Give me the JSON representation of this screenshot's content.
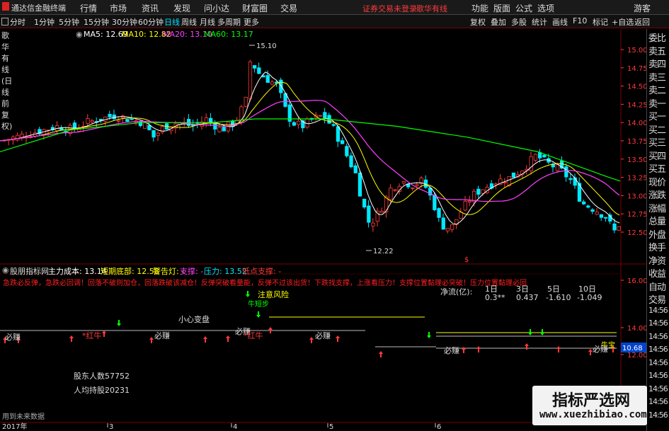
{
  "topbar": {
    "logo": "通达信金融终端",
    "menus": [
      "行情",
      "市场",
      "资讯",
      "发现",
      "问小达",
      "财富圈",
      "交易"
    ],
    "warning": "证券交易未登录",
    "stock_name": "歌华有线",
    "right_menus": [
      "功能",
      "版面",
      "公式",
      "选项"
    ],
    "user": "游客"
  },
  "toolbar": {
    "periods": [
      "分时",
      "1分钟",
      "5分钟",
      "15分钟",
      "30分钟",
      "60分钟",
      "日线",
      "周线",
      "月线",
      "多周期",
      "更多"
    ],
    "active_period": "日线",
    "buttons": [
      "复权",
      "叠加",
      "多股",
      "统计",
      "画线",
      "F10",
      "标记",
      "+自选",
      "返回"
    ]
  },
  "infobar": {
    "title": "歌华有线(日线 前复权)",
    "ma5": "MA5: 12.69",
    "ma10": "MA10: 12.82",
    "ma20": "MA20: 13.10",
    "ma60": "MA60: 13.17"
  },
  "price_axis": [
    "15.00",
    "14.75",
    "14.50",
    "14.25",
    "14.00",
    "13.75",
    "13.50",
    "13.25",
    "13.00",
    "12.75",
    "12.50"
  ],
  "annotations": {
    "high": "15.10",
    "low": "12.22",
    "marker": "$"
  },
  "indicator_bar": {
    "name": "股朋指标网",
    "main_cost": "主力成本: 13.14",
    "short_bottom": "短期底部: 12.58",
    "alert": "警告灯: -",
    "support": "支撑: -",
    "pressure": "压力: 13.52",
    "low_support": "低点支撑: -"
  },
  "scroll_text": "急跌必反弹，急跌必回调！回落不破则加仓，回落跌破该减仓！反弹突破看量能，反弹不过该出货！下跌找支撑，上涨看压力！支撑位置黏理必突破！压力位置黏理必回落！",
  "indicator_axis": [
    "16.00",
    "14.00",
    "12.00"
  ],
  "current_value": "10.68",
  "panel_labels": {
    "careful": "小心变盘",
    "risk": "注意风险",
    "bull": "牛短步",
    "must_earn": "必赚",
    "red_bull": "*红牛",
    "niu_bao": "牛宝"
  },
  "net_flow": {
    "label": "净流(亿):",
    "periods": [
      "1日",
      "3日",
      "5日",
      "10日"
    ],
    "values": [
      "0.3**",
      "0.437",
      "-1.610",
      "-1.049"
    ]
  },
  "shareholders": {
    "count_label": "股东人数:",
    "count_value": "57752",
    "avg_label": "人均持股:",
    "avg_value": "20231"
  },
  "footer": {
    "hint": "用到未来数据",
    "year": "2017年",
    "months": [
      "3",
      "4",
      "5",
      "6"
    ]
  },
  "right_panel": [
    "委比",
    "卖五",
    "卖四",
    "卖三",
    "卖二",
    "卖一",
    "买一",
    "买二",
    "买三",
    "买四",
    "买五",
    "现价",
    "涨跌",
    "涨幅",
    "总量",
    "外盘",
    "换手",
    "净资",
    "收益",
    "自动",
    "交易",
    "14:56",
    "14:56",
    "14:56",
    "14:56",
    "14:56",
    "14:56",
    "14:56",
    "14:56",
    "14:56"
  ],
  "watermark": {
    "title": "指标严选网",
    "url": "www.xuezhibiao.com"
  },
  "colors": {
    "up": "#ff3b3b",
    "down": "#00e8ff",
    "ma5": "#ffffff",
    "ma10": "#ffff00",
    "ma20": "#ff40ff",
    "ma60": "#00ff00"
  }
}
